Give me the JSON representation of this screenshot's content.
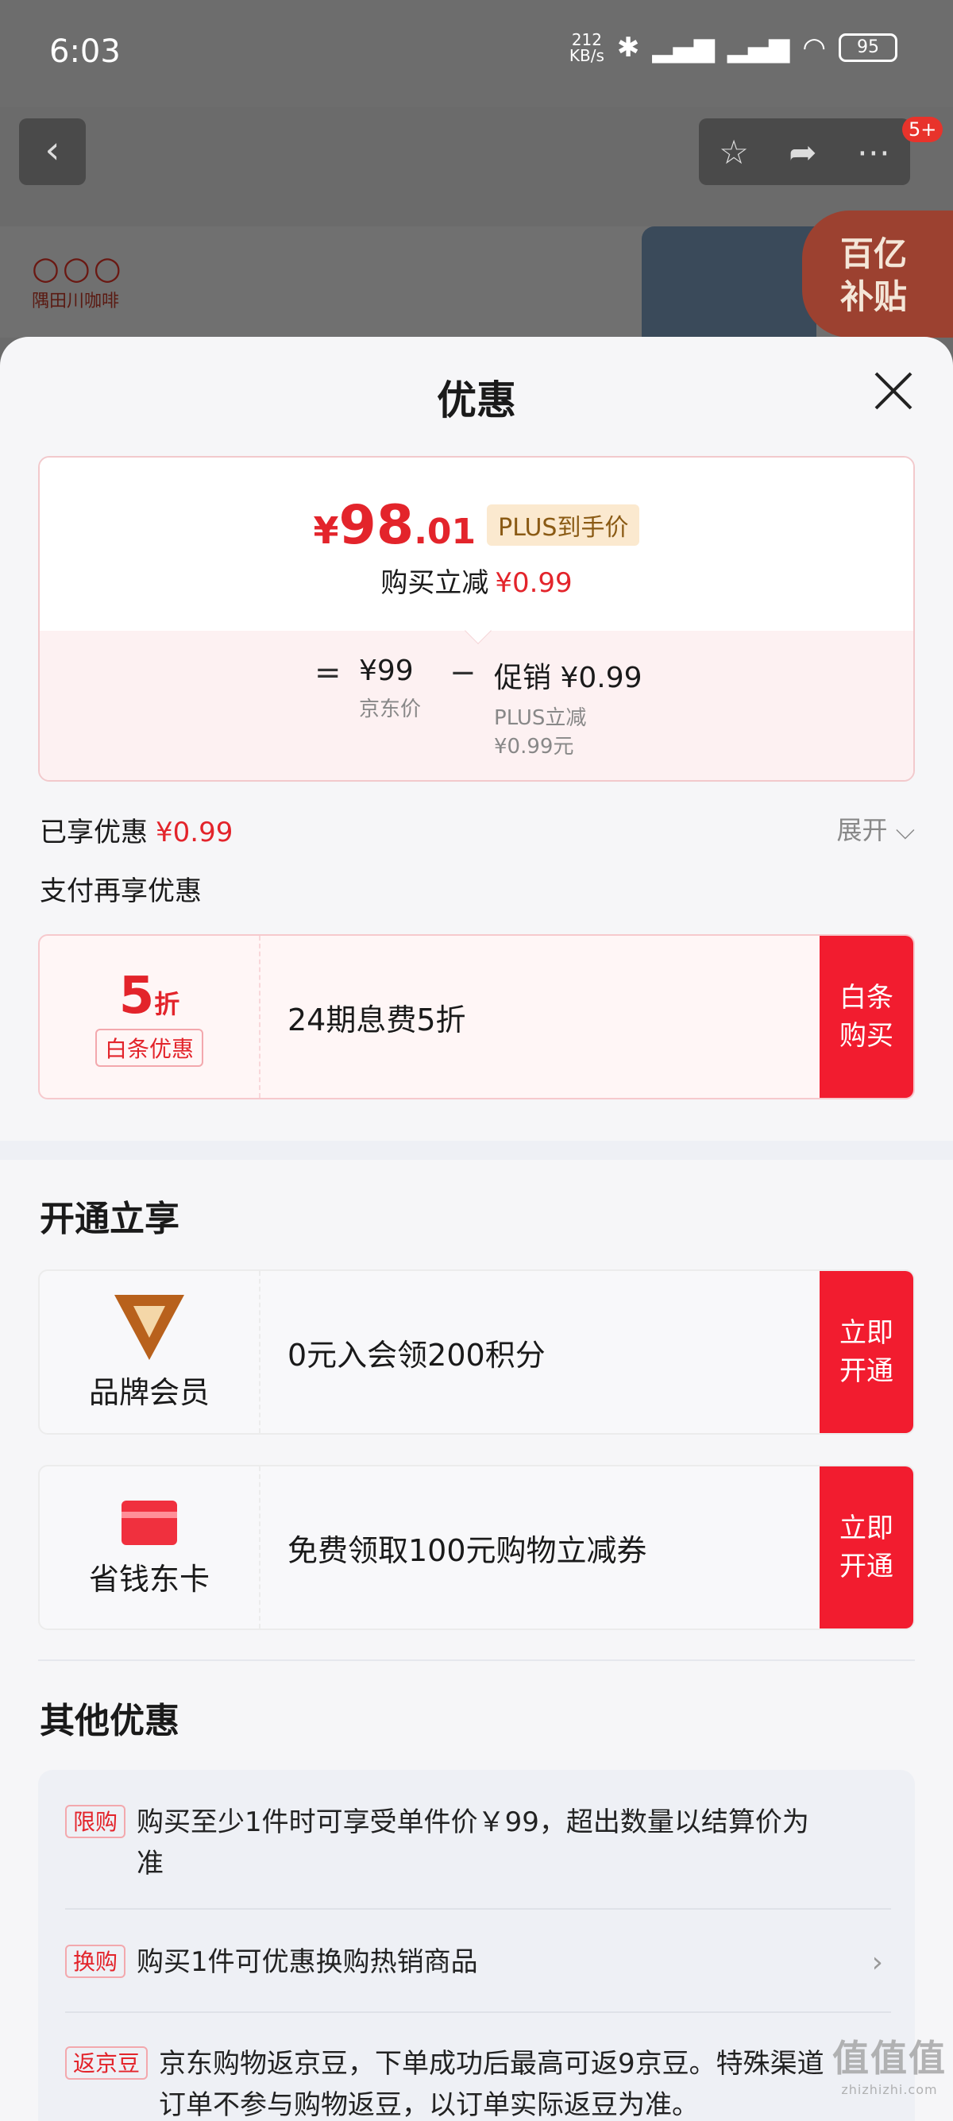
{
  "status_bar": {
    "time": "6:03",
    "net_speed_value": "212",
    "net_speed_unit": "KB/s",
    "battery": "95"
  },
  "nav": {
    "badge": "5+"
  },
  "banner": {
    "brand_dots": "○○○",
    "brand_name": "隅田川咖啡",
    "subsidy_line1": "百亿",
    "subsidy_line2": "补贴"
  },
  "sheet": {
    "title": "优惠",
    "price": {
      "currency": "¥",
      "integer": "98",
      "decimal": ".01",
      "plus_tag": "PLUS到手价",
      "saved_label": "购买立减",
      "saved_amount": "¥0.99"
    },
    "formula": {
      "equals": "=",
      "minus": "−",
      "jd_price_value": "¥99",
      "jd_price_label": "京东价",
      "promo_value": "促销 ¥0.99",
      "promo_label_1": "PLUS立减",
      "promo_label_2": "¥0.99元"
    },
    "enjoyed_label": "已享优惠",
    "enjoyed_amount": "¥0.99",
    "expand_label": "展开",
    "pay_more_label": "支付再享优惠",
    "baitiao": {
      "discount_num": "5",
      "discount_unit": "折",
      "tag": "白条优惠",
      "text": "24期息费5折",
      "button": "白条\n购买"
    },
    "open_section_title": "开通立享",
    "brand_member": {
      "label": "品牌会员",
      "text": "0元入会领200积分",
      "button": "立即\n开通"
    },
    "saving_card": {
      "label": "省钱东卡",
      "text": "免费领取100元购物立减券",
      "button": "立即\n开通"
    },
    "other_section_title": "其他优惠",
    "other_items": [
      {
        "tag": "限购",
        "text": "购买至少1件时可享受单件价￥99，超出数量以结算价为准"
      },
      {
        "tag": "换购",
        "text": "购买1件可优惠换购热销商品"
      },
      {
        "tag": "返京豆",
        "text": "京东购物返京豆，下单成功后最高可返9京豆。特殊渠道订单不参与购物返豆，以订单实际返豆为准。"
      }
    ]
  },
  "watermark": {
    "main": "值值值",
    "sub": "zhizhizhi.com"
  },
  "colors": {
    "accent_red": "#f21c2f",
    "price_red": "#e3242b",
    "plus_gold": "#8a5a14"
  }
}
